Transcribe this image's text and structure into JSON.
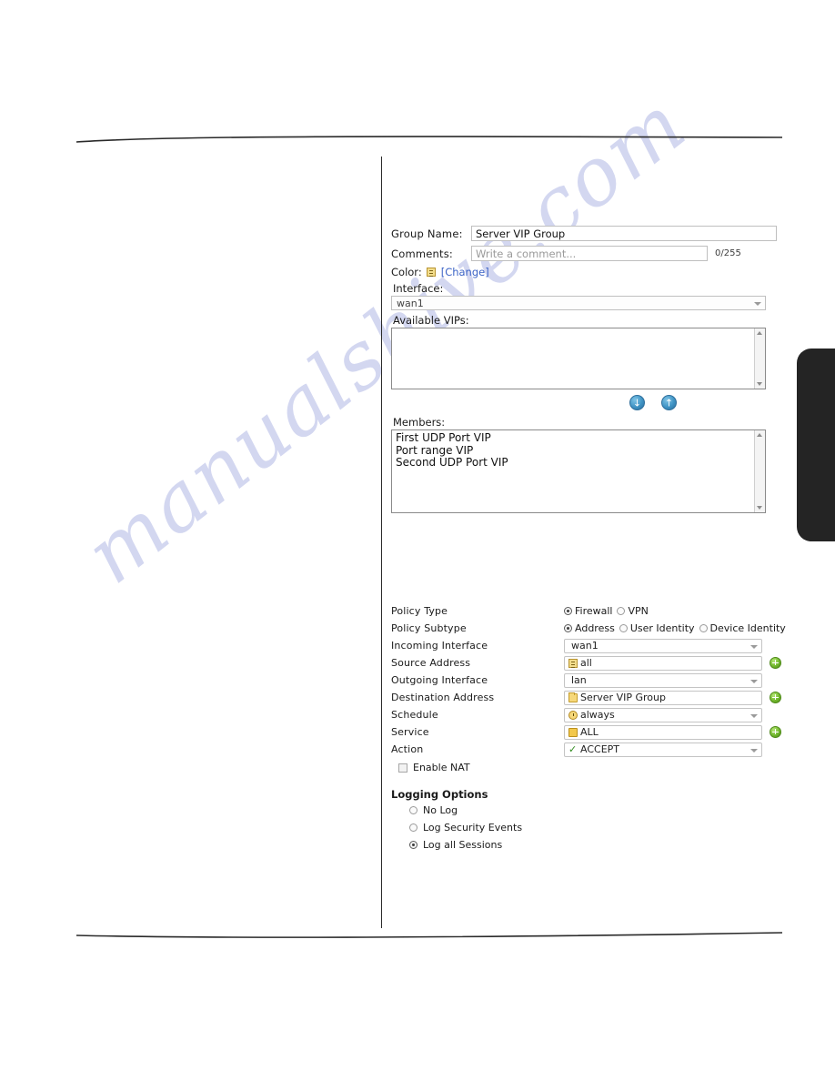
{
  "page": {
    "watermark": "manualshive.com"
  },
  "vip_group_form": {
    "group_name_label": "Group Name:",
    "group_name_value": "Server VIP Group",
    "comments_label": "Comments:",
    "comments_placeholder": "Write a comment...",
    "comments_counter": "0/255",
    "color_label": "Color:",
    "color_icon": "color-swatch-icon",
    "change_link": "[Change]",
    "interface_label": "Interface:",
    "interface_value": "wan1",
    "available_vips_label": "Available VIPs:",
    "available_vips": [],
    "move_down_glyph": "↓",
    "move_up_glyph": "↑",
    "members_label": "Members:",
    "members": [
      "First UDP Port VIP",
      "Port range VIP",
      "Second UDP Port VIP"
    ]
  },
  "policy_form": {
    "policy_type": {
      "label": "Policy Type",
      "options": [
        {
          "label": "Firewall",
          "selected": true
        },
        {
          "label": "VPN",
          "selected": false
        }
      ]
    },
    "policy_subtype": {
      "label": "Policy Subtype",
      "options": [
        {
          "label": "Address",
          "selected": true
        },
        {
          "label": "User Identity",
          "selected": false
        },
        {
          "label": "Device Identity",
          "selected": false
        }
      ]
    },
    "incoming_interface": {
      "label": "Incoming Interface",
      "value": "wan1"
    },
    "source_address": {
      "label": "Source Address",
      "value": "all",
      "icon": "address-list-icon"
    },
    "outgoing_interface": {
      "label": "Outgoing Interface",
      "value": "lan"
    },
    "destination_address": {
      "label": "Destination Address",
      "value": "Server VIP Group",
      "icon": "folder-icon"
    },
    "schedule": {
      "label": "Schedule",
      "value": "always",
      "icon": "clock-icon"
    },
    "service": {
      "label": "Service",
      "value": "ALL",
      "icon": "services-folder-icon"
    },
    "action": {
      "label": "Action",
      "value": "ACCEPT",
      "icon": "green-check-icon"
    },
    "enable_nat": {
      "label": "Enable NAT",
      "checked": false
    },
    "logging_options": {
      "title": "Logging Options",
      "options": [
        {
          "label": "No Log",
          "selected": false
        },
        {
          "label": "Log Security Events",
          "selected": false
        },
        {
          "label": "Log all Sessions",
          "selected": true
        }
      ]
    }
  },
  "colors": {
    "link": "#3b63c6",
    "accent_green": "#72b82e",
    "accent_blue": "#3f93c4",
    "watermark": "#b9bfe8",
    "side_tab": "#242424"
  }
}
